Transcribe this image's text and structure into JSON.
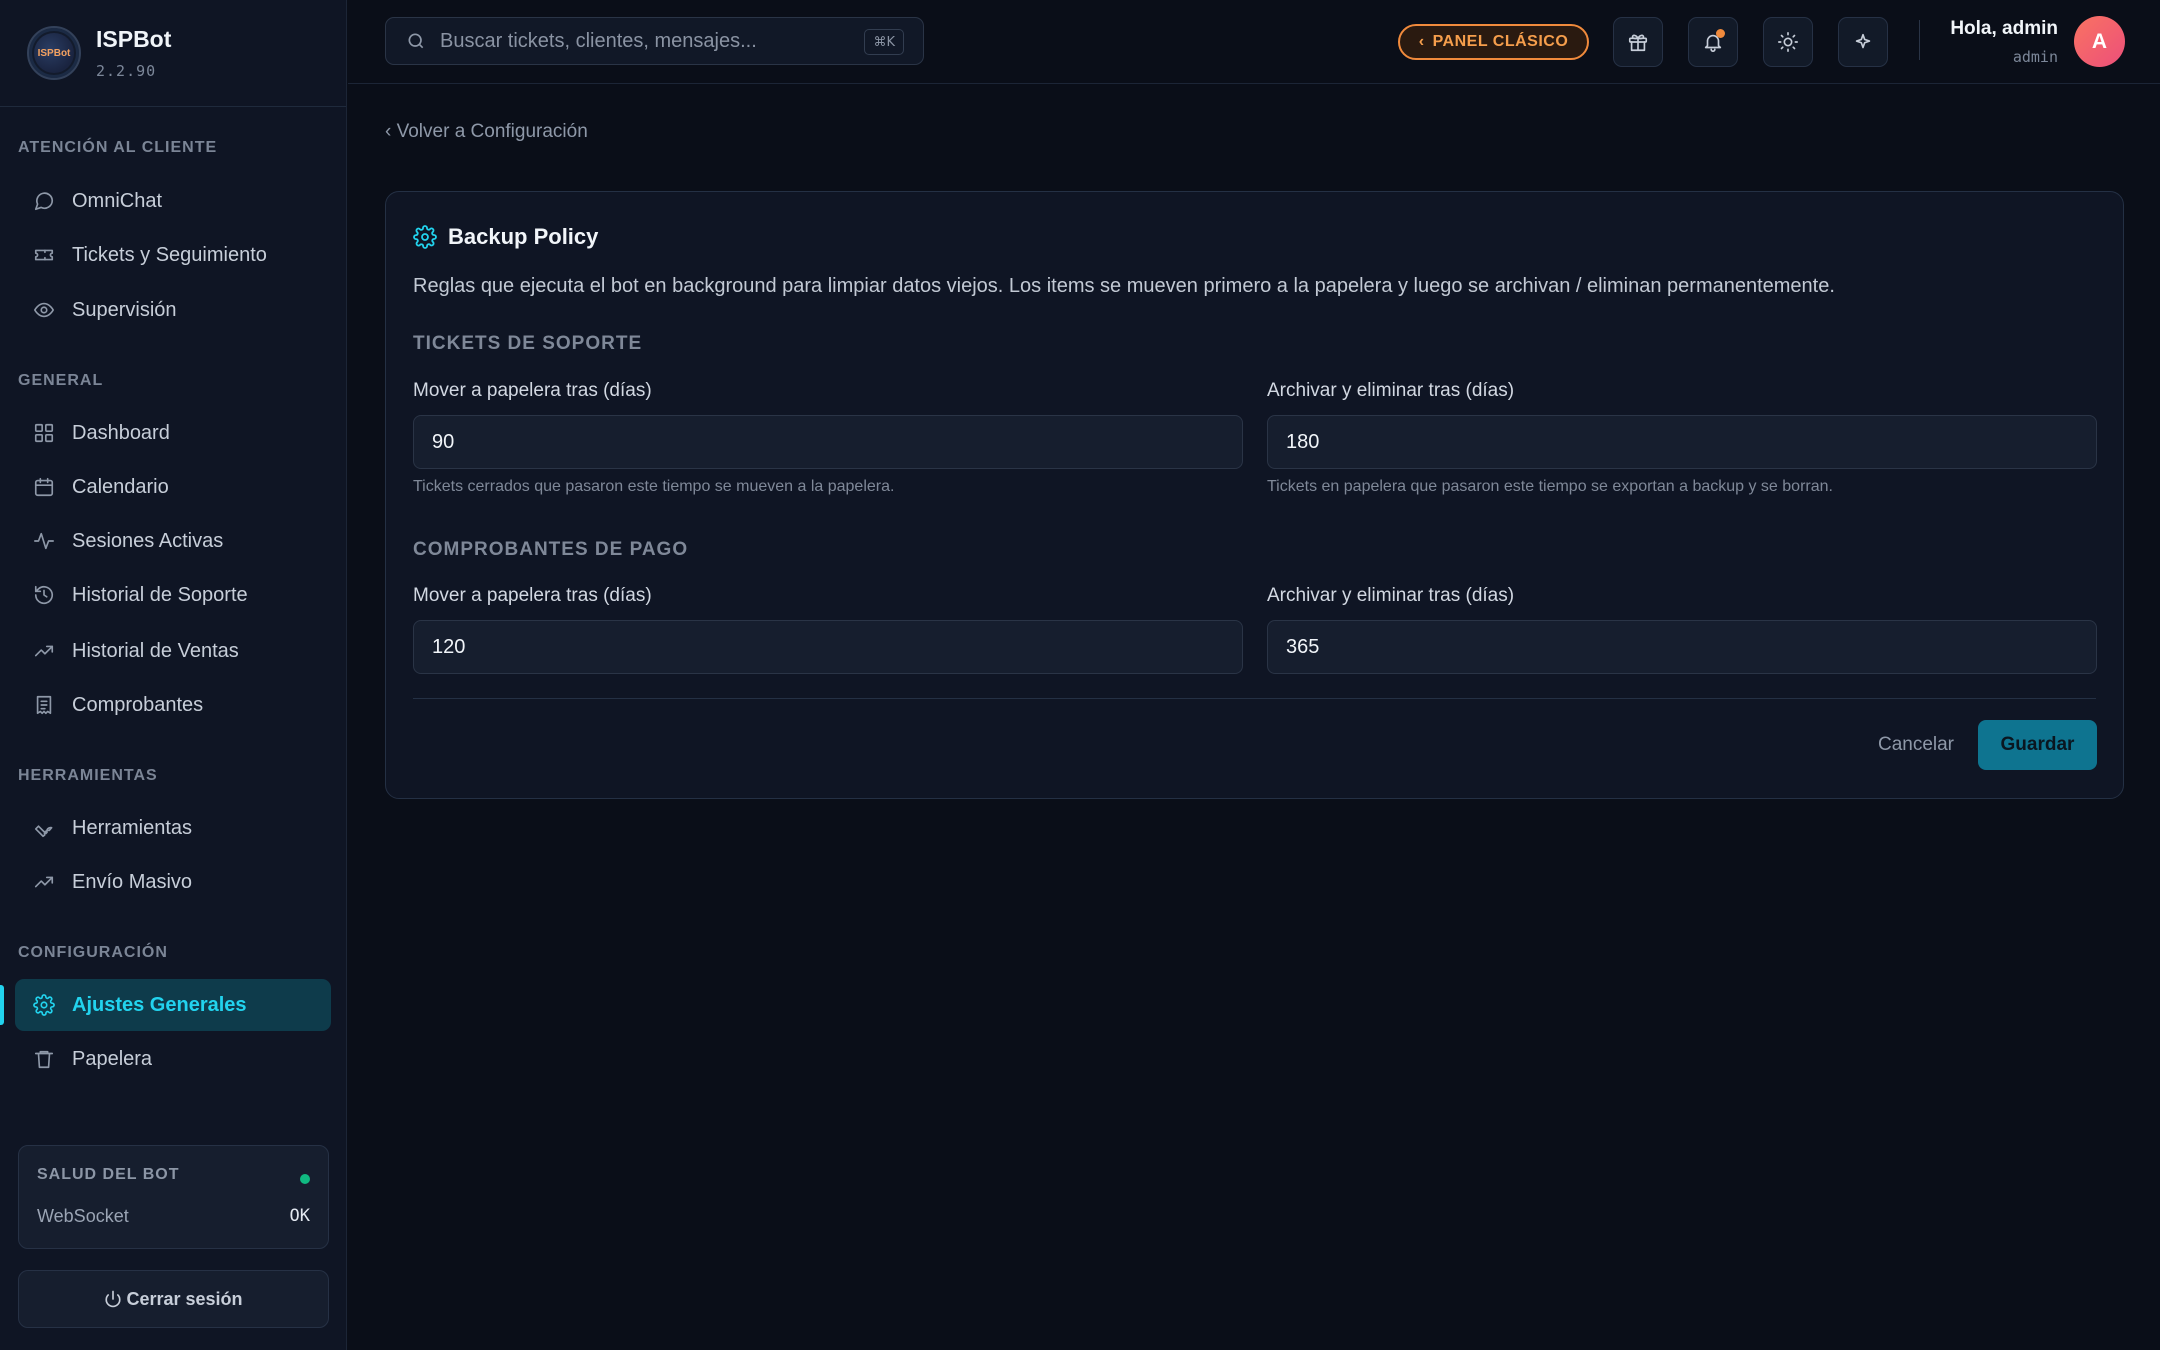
{
  "brand": {
    "name": "ISPBot",
    "version": "2.2.90",
    "logo_text": "ISPBot"
  },
  "sidebar": {
    "sections": [
      {
        "title": "ATENCIÓN AL CLIENTE"
      },
      {
        "title": "GENERAL"
      },
      {
        "title": "HERRAMIENTAS"
      },
      {
        "title": "CONFIGURACIÓN"
      }
    ],
    "items": [
      {
        "label": "OmniChat",
        "icon": "chat-icon"
      },
      {
        "label": "Tickets y Seguimiento",
        "icon": "ticket-icon"
      },
      {
        "label": "Supervisión",
        "icon": "eye-icon"
      },
      {
        "label": "Dashboard",
        "icon": "grid-icon"
      },
      {
        "label": "Calendario",
        "icon": "calendar-icon"
      },
      {
        "label": "Sesiones Activas",
        "icon": "activity-icon"
      },
      {
        "label": "Historial de Soporte",
        "icon": "history-icon"
      },
      {
        "label": "Historial de Ventas",
        "icon": "trending-icon"
      },
      {
        "label": "Comprobantes",
        "icon": "receipt-icon"
      },
      {
        "label": "Herramientas",
        "icon": "wrench-icon"
      },
      {
        "label": "Envío Masivo",
        "icon": "trending-icon"
      },
      {
        "label": "Ajustes Generales",
        "icon": "gear-icon",
        "active": true
      },
      {
        "label": "Papelera",
        "icon": "trash-icon"
      }
    ],
    "health": {
      "title": "SALUD DEL BOT",
      "row_label": "WebSocket",
      "row_value": "OK",
      "status_color": "#10b981"
    },
    "logout_label": "Cerrar sesión"
  },
  "topbar": {
    "search": {
      "placeholder": "Buscar tickets, clientes, mensajes...",
      "shortcut": "⌘K"
    },
    "classic_panel_label": "PANEL CLÁSICO",
    "user": {
      "greeting": "Hola, admin",
      "role": "admin",
      "avatar_initial": "A"
    }
  },
  "main": {
    "back_link": "‹ Volver a Configuración",
    "card": {
      "title": "Backup Policy",
      "description": "Reglas que ejecuta el bot en background para limpiar datos viejos. Los items se mueven primero a la papelera y luego se archivan / eliminan permanentemente.",
      "sections": [
        {
          "title": "TICKETS DE SOPORTE",
          "fields": [
            {
              "label": "Mover a papelera tras (días)",
              "value": "90",
              "help": "Tickets cerrados que pasaron este tiempo se mueven a la papelera."
            },
            {
              "label": "Archivar y eliminar tras (días)",
              "value": "180",
              "help": "Tickets en papelera que pasaron este tiempo se exportan a backup y se borran."
            }
          ]
        },
        {
          "title": "COMPROBANTES DE PAGO",
          "fields": [
            {
              "label": "Mover a papelera tras (días)",
              "value": "120"
            },
            {
              "label": "Archivar y eliminar tras (días)",
              "value": "365"
            }
          ]
        }
      ],
      "cancel_label": "Cancelar",
      "save_label": "Guardar"
    }
  },
  "colors": {
    "accent": "#22d3ee",
    "warning": "#f08a3c",
    "save": "#0e7490"
  }
}
